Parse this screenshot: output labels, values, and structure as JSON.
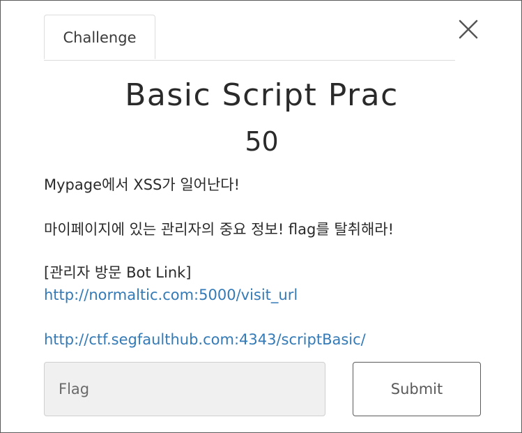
{
  "tabs": [
    {
      "label": "Challenge"
    }
  ],
  "challenge": {
    "title": "Basic Script Prac",
    "points": "50",
    "description_lines": [
      "Mypage에서 XSS가 일어난다!",
      "마이페이지에 있는 관리자의 중요 정보! flag를 탈취해라!",
      "[관리자 방문 Bot Link]"
    ],
    "links": [
      "http://normaltic.com:5000/visit_url",
      "http://ctf.segfaulthub.com:4343/scriptBasic/"
    ]
  },
  "form": {
    "flag_placeholder": "Flag",
    "submit_label": "Submit"
  },
  "icons": {
    "close": "close-icon"
  },
  "colors": {
    "link": "#337ab7",
    "input_bg": "#f0f0f0"
  }
}
